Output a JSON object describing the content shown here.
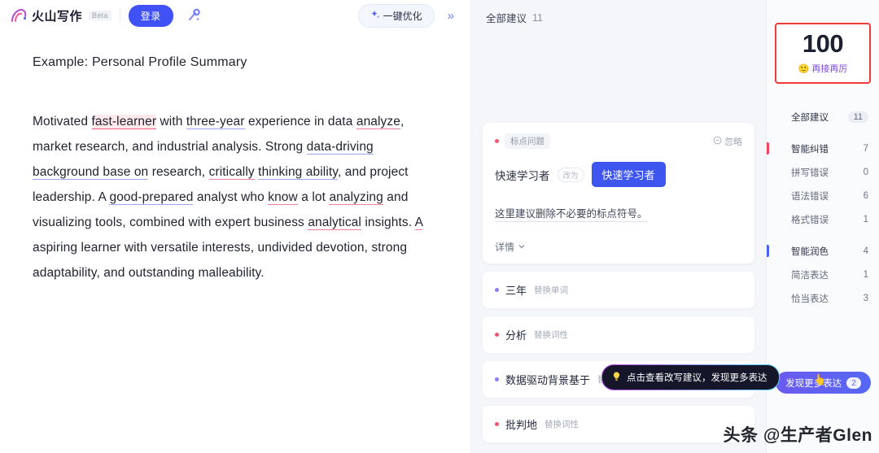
{
  "topbar": {
    "brand_name": "火山写作",
    "beta_badge": "Beta",
    "login_label": "登录",
    "magic_icon": "magic-wand-icon",
    "optimize_label": "一键优化",
    "optimize_icon": "sparkle-icon",
    "collapse_icon": "chevron-double-right-icon",
    "collapse_label": "»"
  },
  "document": {
    "title": "Example: Personal Profile Summary",
    "paragraph": {
      "segments": [
        {
          "text": "Motivated ",
          "mark": "none"
        },
        {
          "text": "fast-learner",
          "mark": "error-highlight"
        },
        {
          "text": " with ",
          "mark": "none"
        },
        {
          "text": "three-year",
          "mark": "blue-underline"
        },
        {
          "text": " experience in data ",
          "mark": "none"
        },
        {
          "text": "analyze",
          "mark": "red-underline"
        },
        {
          "text": ", market research, and industrial analysis. Strong ",
          "mark": "none"
        },
        {
          "text": "data-driving background base on",
          "mark": "blue-underline"
        },
        {
          "text": " research, ",
          "mark": "none"
        },
        {
          "text": "critically",
          "mark": "red-underline"
        },
        {
          "text": " ",
          "mark": "none"
        },
        {
          "text": "thinking ability",
          "mark": "blue-underline"
        },
        {
          "text": ", and project leadership. A ",
          "mark": "none"
        },
        {
          "text": "good-prepared",
          "mark": "blue-underline"
        },
        {
          "text": " analyst who ",
          "mark": "none"
        },
        {
          "text": "know",
          "mark": "red-underline"
        },
        {
          "text": " a lot ",
          "mark": "none"
        },
        {
          "text": "analyzing",
          "mark": "red-underline"
        },
        {
          "text": " and visualizing tools, combined with expert business ",
          "mark": "none"
        },
        {
          "text": "analytical",
          "mark": "red-underline"
        },
        {
          "text": " insights. ",
          "mark": "none"
        },
        {
          "text": "A",
          "mark": "red-underline"
        },
        {
          "text": " aspiring learner with versatile interests, undivided devotion, strong adaptability, and outstanding malleability.",
          "mark": "none"
        }
      ]
    }
  },
  "suggestions_panel": {
    "header_title": "全部建议",
    "header_count": "11",
    "main_card": {
      "category_tag": "标点问题",
      "dot_color": "#f2556f",
      "ignore_label": "忽略",
      "ignore_icon": "minus-circle-icon",
      "original_text": "快速学习者",
      "arrow_label": "改为",
      "suggested_text": "快速学习者",
      "explanation": "这里建议删除不必要的标点符号。",
      "detail_label": "详情",
      "detail_icon": "chevron-down-icon"
    },
    "mini_cards": [
      {
        "word": "三年",
        "tag": "替换单词",
        "dot_color": "#8b7cf0"
      },
      {
        "word": "分析",
        "tag": "替换词性",
        "dot_color": "#f2556f"
      },
      {
        "word": "数据驱动背景基于",
        "tag": "替换短语",
        "dot_color": "#8b7cf0"
      },
      {
        "word": "批判地",
        "tag": "替换词性",
        "dot_color": "#f2556f"
      }
    ],
    "tooltip": {
      "icon": "lightbulb-icon",
      "text": "点击查看改写建议，发现更多表达"
    }
  },
  "sidebar": {
    "score": {
      "value": "100",
      "label": "再接再厉",
      "emoji": "🙂",
      "highlight_color": "#f03a3a"
    },
    "all_row": {
      "label": "全部建议",
      "count": "11"
    },
    "groups": [
      {
        "label": "智能纠错",
        "count": "7",
        "bar_color": "#f0455e",
        "items": [
          {
            "label": "拼写错误",
            "count": "0"
          },
          {
            "label": "语法错误",
            "count": "6"
          },
          {
            "label": "格式错误",
            "count": "1"
          }
        ]
      },
      {
        "label": "智能润色",
        "count": "4",
        "bar_color": "#4a63f2",
        "items": [
          {
            "label": "简洁表达",
            "count": "1"
          },
          {
            "label": "恰当表达",
            "count": "3"
          }
        ]
      }
    ],
    "more_button": {
      "label": "发现更多表达",
      "count": "2"
    }
  },
  "watermark": "头条 @生产者Glen"
}
